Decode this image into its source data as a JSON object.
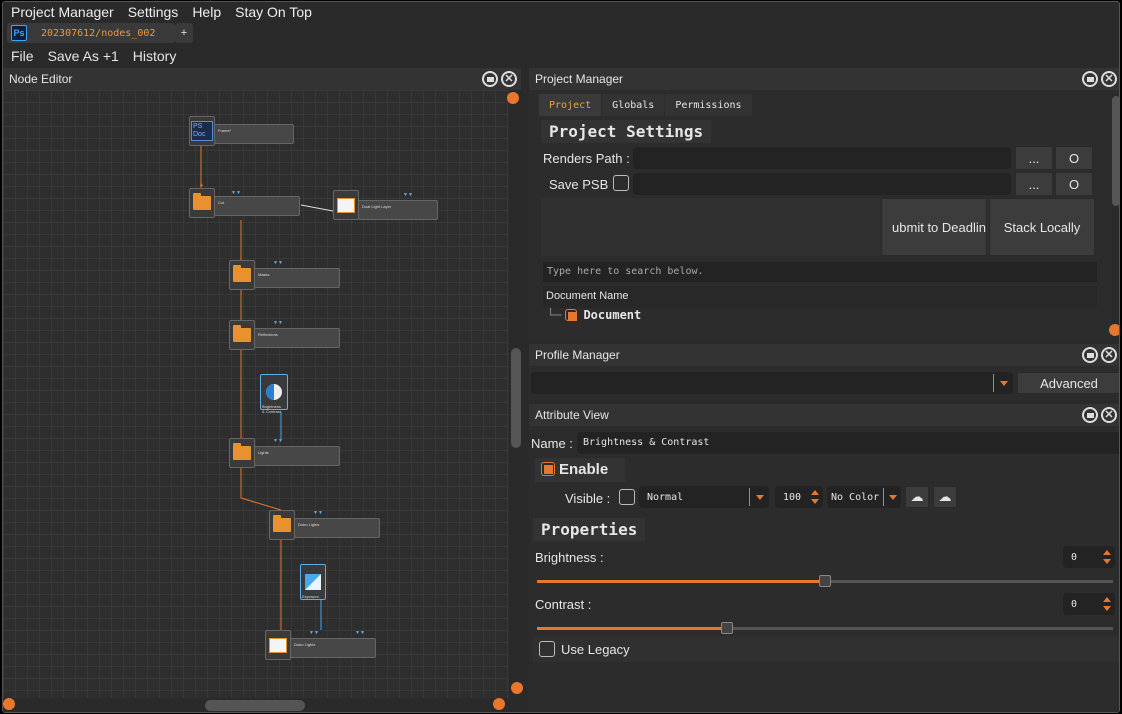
{
  "menu": [
    "Project Manager",
    "Settings",
    "Help",
    "Stay On Top"
  ],
  "doc_tab": {
    "title": "202307612/nodes_002",
    "icon": "Ps",
    "add": "+"
  },
  "menu2": [
    "File",
    "Save As +1",
    "History"
  ],
  "node_editor": {
    "title": "Node Editor",
    "nodes": [
      {
        "label": "Frame*"
      },
      {
        "label": "Cut"
      },
      {
        "label": "Dual Light Layer"
      },
      {
        "label": "Masks"
      },
      {
        "label": "Reflections"
      },
      {
        "label": "Brightness & Contrast"
      },
      {
        "label": "Lights"
      },
      {
        "label": "Dubo Lights"
      },
      {
        "label": "Exposure"
      },
      {
        "label": "Dubo Lights"
      }
    ],
    "doc_icon_lines": [
      "PS",
      "Doc"
    ]
  },
  "project_manager": {
    "title": "Project Manager",
    "tabs": [
      "Project",
      "Globals",
      "Permissions"
    ],
    "section": "Project Settings",
    "renders_path_label": "Renders Path :",
    "save_psb_label": "Save PSB",
    "browse": "...",
    "open": "O",
    "submit": "ubmit to Deadlin",
    "stack": "Stack Locally",
    "search_placeholder": "Type here to search below.",
    "doc_header": "Document Name",
    "doc_item": "Document",
    "tree_glyph": "└─"
  },
  "profile_manager": {
    "title": "Profile Manager",
    "advanced": "Advanced"
  },
  "attribute_view": {
    "title": "Attribute View",
    "name_label": "Name :",
    "name_value": "Brightness & Contrast",
    "enable": "Enable",
    "visible": "Visible :",
    "blend": "Normal",
    "opacity": "100",
    "color": "No Color",
    "properties": "Properties",
    "brightness_label": "Brightness :",
    "brightness_value": "0",
    "brightness_level": 0.5,
    "contrast_label": "Contrast :",
    "contrast_value": "0",
    "contrast_level": 0.33,
    "legacy": "Use Legacy"
  },
  "accent": "#e8772e"
}
